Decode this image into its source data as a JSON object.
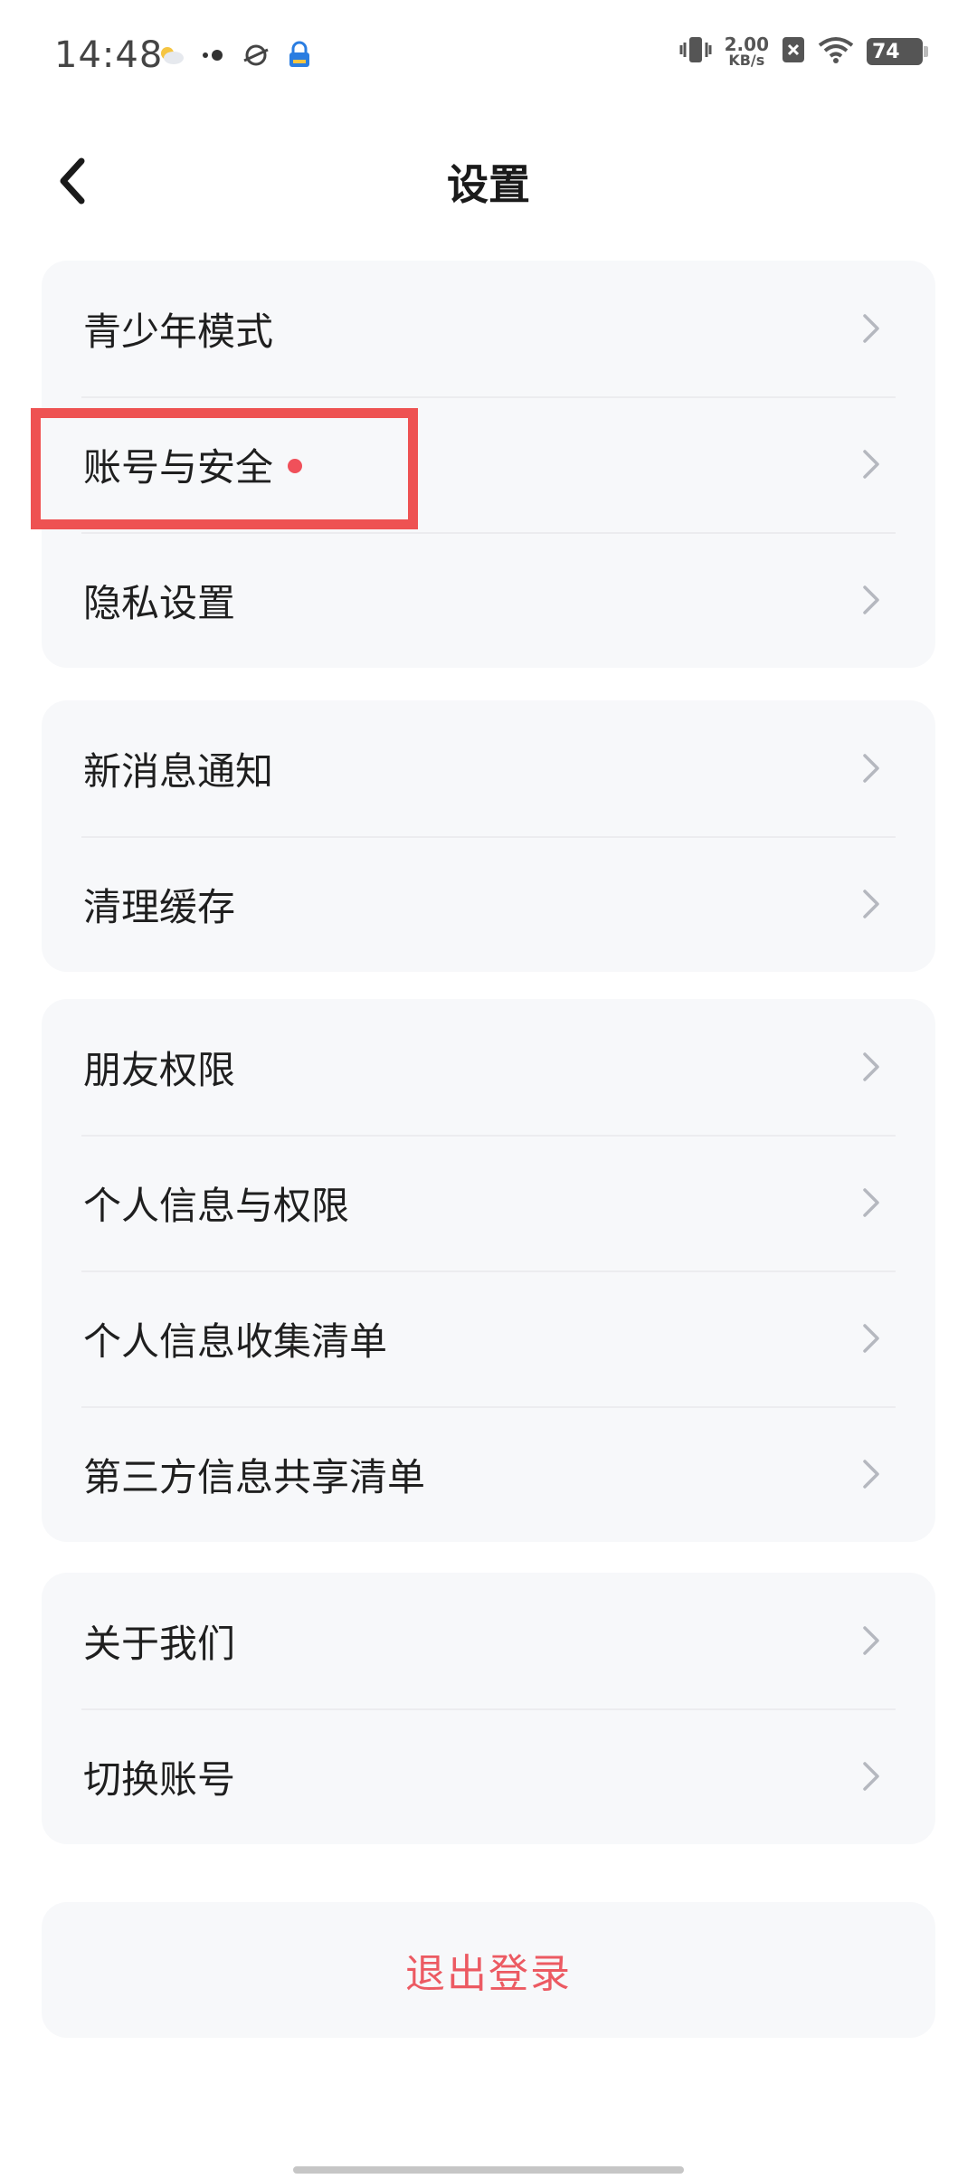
{
  "status_bar": {
    "time": "14:48",
    "net_speed_value": "2.00",
    "net_speed_unit": "KB/s",
    "battery": "74",
    "icons": [
      "weather-cloud-icon",
      "dots-icon",
      "planet-icon",
      "app-lock-icon",
      "vibrate-icon",
      "no-sim-icon",
      "wifi-icon",
      "battery-icon"
    ]
  },
  "header": {
    "title": "设置",
    "back_icon": "chevron-left-icon"
  },
  "groups": [
    {
      "items": [
        {
          "label": "青少年模式"
        },
        {
          "label": "账号与安全",
          "has_red_dot": true,
          "highlighted": true
        },
        {
          "label": "隐私设置"
        }
      ]
    },
    {
      "items": [
        {
          "label": "新消息通知"
        },
        {
          "label": "清理缓存"
        }
      ]
    },
    {
      "items": [
        {
          "label": "朋友权限"
        },
        {
          "label": "个人信息与权限"
        },
        {
          "label": "个人信息收集清单"
        },
        {
          "label": "第三方信息共享清单"
        }
      ]
    },
    {
      "items": [
        {
          "label": "关于我们"
        },
        {
          "label": "切换账号"
        }
      ]
    }
  ],
  "logout": {
    "label": "退出登录"
  },
  "colors": {
    "accent_red": "#ec5a62",
    "highlight_box": "#ee5252",
    "group_bg": "#f7f8fa"
  }
}
